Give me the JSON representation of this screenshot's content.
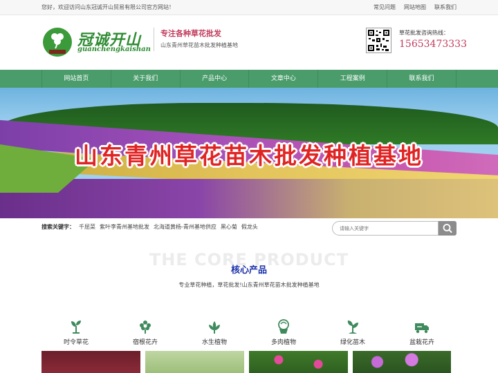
{
  "topbar": {
    "welcome": "您好，欢迎访问山东冠诚开山贸易有限公司官方网站！",
    "links": [
      "常见问题",
      "网站地图",
      "联系我们"
    ]
  },
  "header": {
    "logo_cn": "冠诚开山",
    "logo_en": "guanchengkaishan",
    "slogan": "专注各种草花批发",
    "subslogan": "山东青州草花苗木批发种植基地",
    "hotline_label": "草花批发咨询热线：",
    "hotline": "15653473333"
  },
  "nav": [
    "网站首页",
    "关于我们",
    "产品中心",
    "文章中心",
    "工程案例",
    "联系我们"
  ],
  "banner": {
    "title": "山东青州草花苗木批发种植基地"
  },
  "search": {
    "keywords_label": "搜索关键字：",
    "keywords": [
      "千屈菜",
      "紫叶李青州基地批发",
      "北海道黄杨-青州基地供应",
      "黑心菊",
      "假龙头"
    ],
    "placeholder": "请输入关键字"
  },
  "core": {
    "ghost": "THE CORE PRODUCT",
    "title": "核心产品",
    "subtitle": "专业草花种植，草花批发!山东青州草花苗木批发种植基地"
  },
  "categories": [
    {
      "label": "时令草花",
      "icon": "seedling-icon"
    },
    {
      "label": "宿根花卉",
      "icon": "flower-icon"
    },
    {
      "label": "水生植物",
      "icon": "lotus-icon"
    },
    {
      "label": "多肉植物",
      "icon": "succulent-pot-icon"
    },
    {
      "label": "绿化苗木",
      "icon": "sapling-icon"
    },
    {
      "label": "盆栽花卉",
      "icon": "truck-icon"
    }
  ],
  "colors": {
    "nav_green": "#4a9c6b",
    "accent_red": "#c03a5a",
    "core_blue": "#1a2fa8"
  }
}
